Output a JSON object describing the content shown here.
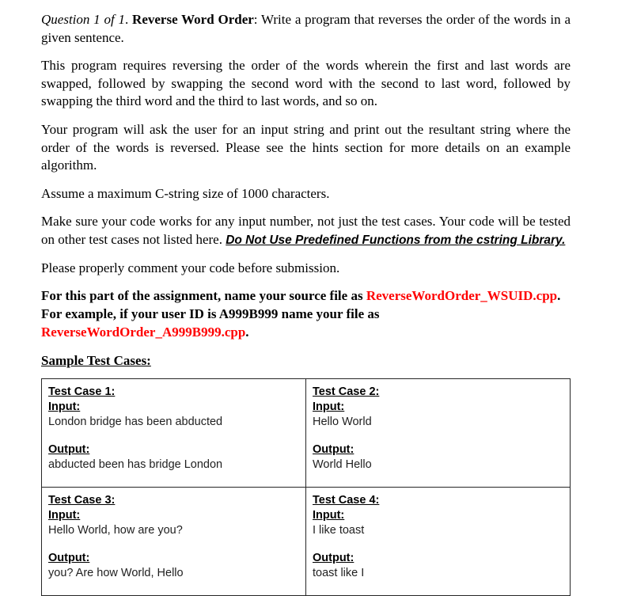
{
  "document": {
    "question_label": "Question 1 of 1",
    "question_title": "Reverse Word Order",
    "intro_rest": ": Write a program that reverses the order of the words in a given sentence.",
    "paragraphs": [
      "This program requires reversing the order of the words wherein the first and last words are swapped, followed by swapping the second word with the second to last word, followed by swapping the third word and the third to last words, and so on.",
      "Your program will ask the user for an input string and print out the resultant string where the order of the words is reversed. Please see the hints section for more details on an example algorithm.",
      "Assume a maximum C-string size of 1000 characters."
    ],
    "warning_paragraph": {
      "lead": "Make sure your code works for any input number, not just the test cases. Your code will be tested on other test cases not listed here. ",
      "emphasis": "Do Not Use Predefined Functions from the cstring Library."
    },
    "comment_paragraph": "Please properly comment your code before submission.",
    "naming_instructions": {
      "line1_prefix": "For this part of the assignment, name your source file as ",
      "line1_filename": "ReverseWordOrder_WSUID.cpp",
      "line1_suffix": ".",
      "line2": "For example, if your user ID is A999B999 name your file as ",
      "line3_filename": "ReverseWordOrder_A999B999.cpp",
      "line3_suffix": "."
    },
    "section_heading": "Sample Test Cases:",
    "labels": {
      "input": "Input:",
      "output": "Output:"
    },
    "test_cases": [
      {
        "title": "Test Case 1:",
        "input": "London bridge has been abducted",
        "output": "abducted been has bridge London"
      },
      {
        "title": "Test Case 2:",
        "input": "Hello World",
        "output": "World Hello"
      },
      {
        "title": "Test Case 3:",
        "input": "Hello World, how are you?",
        "output": "you? Are how World, Hello"
      },
      {
        "title": "Test Case 4:",
        "input": "I like toast",
        "output": "toast like I"
      }
    ],
    "colors": {
      "accent_red": "#FF0000",
      "text_black": "#000000",
      "table_border": "#262626"
    }
  }
}
